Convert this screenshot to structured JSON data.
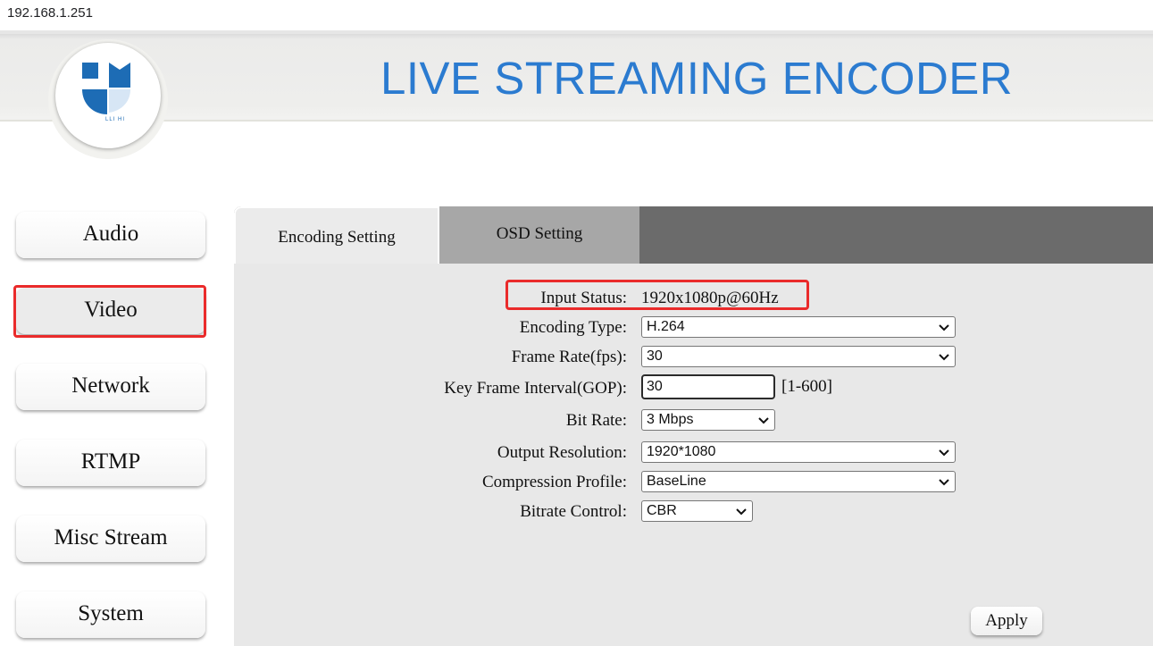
{
  "browser": {
    "address": "192.168.1.251"
  },
  "header": {
    "title": "LIVE STREAMING ENCODER",
    "logo_text": "LLI HI"
  },
  "sidebar": {
    "items": [
      {
        "label": "Audio"
      },
      {
        "label": "Video"
      },
      {
        "label": "Network"
      },
      {
        "label": "RTMP"
      },
      {
        "label": "Misc Stream"
      },
      {
        "label": "System"
      }
    ],
    "active": "Video"
  },
  "tabs": [
    {
      "label": "Encoding Setting",
      "active": true
    },
    {
      "label": "OSD Setting",
      "active": false
    }
  ],
  "form": {
    "input_status": {
      "label": "Input Status:",
      "value": "1920x1080p@60Hz"
    },
    "encoding_type": {
      "label": "Encoding Type:",
      "value": "H.264"
    },
    "frame_rate": {
      "label": "Frame Rate(fps):",
      "value": "30"
    },
    "gop": {
      "label": "Key Frame Interval(GOP):",
      "value": "30",
      "range": "[1-600]"
    },
    "bit_rate": {
      "label": "Bit Rate:",
      "value": "3 Mbps"
    },
    "output_resolution": {
      "label": "Output Resolution:",
      "value": "1920*1080"
    },
    "compression_profile": {
      "label": "Compression Profile:",
      "value": "BaseLine"
    },
    "bitrate_control": {
      "label": "Bitrate Control:",
      "value": "CBR"
    }
  },
  "apply_label": "Apply",
  "colors": {
    "title_blue": "#2b7bd0",
    "highlight_red": "#ea2b2b",
    "tab_dark": "#6b6b6b",
    "tab_inactive": "#a7a7a7",
    "panel_bg": "#e8e8e8"
  },
  "icons": [
    "logo-icon",
    "chevron-down-icon"
  ]
}
